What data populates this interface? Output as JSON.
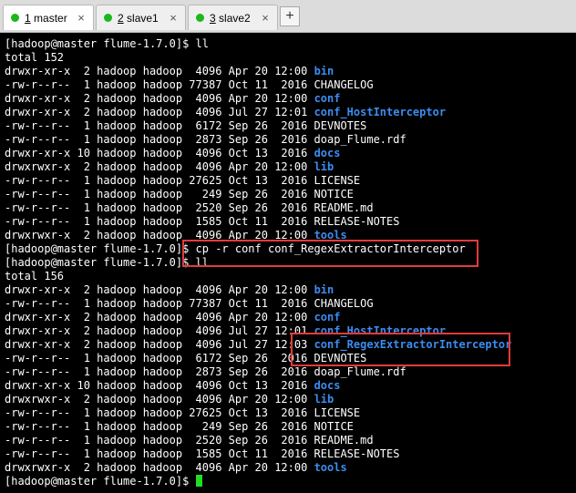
{
  "tabs": [
    {
      "num": "1",
      "name": "master",
      "close": "×"
    },
    {
      "num": "2",
      "name": "slave1",
      "close": "×"
    },
    {
      "num": "3",
      "name": "slave2",
      "close": "×"
    }
  ],
  "add_tab_label": "+",
  "colors": {
    "dir": "#3b8df0",
    "highlight": "#e23b3b",
    "status_dot": "#1bb81b",
    "cursor": "#22dd22"
  },
  "terminal": {
    "lines": [
      {
        "text": "[hadoop@master flume-1.7.0]$ ll"
      },
      {
        "text": "total 152"
      },
      {
        "text": "drwxr-xr-x  2 hadoop hadoop  4096 Apr 20 12:00 ",
        "dir": "bin"
      },
      {
        "text": "-rw-r--r--  1 hadoop hadoop 77387 Oct 11  2016 CHANGELOG"
      },
      {
        "text": "drwxr-xr-x  2 hadoop hadoop  4096 Apr 20 12:00 ",
        "dir": "conf"
      },
      {
        "text": "drwxr-xr-x  2 hadoop hadoop  4096 Jul 27 12:01 ",
        "dir": "conf_HostInterceptor"
      },
      {
        "text": "-rw-r--r--  1 hadoop hadoop  6172 Sep 26  2016 DEVNOTES"
      },
      {
        "text": "-rw-r--r--  1 hadoop hadoop  2873 Sep 26  2016 doap_Flume.rdf"
      },
      {
        "text": "drwxr-xr-x 10 hadoop hadoop  4096 Oct 13  2016 ",
        "dir": "docs"
      },
      {
        "text": "drwxrwxr-x  2 hadoop hadoop  4096 Apr 20 12:00 ",
        "dir": "lib"
      },
      {
        "text": "-rw-r--r--  1 hadoop hadoop 27625 Oct 13  2016 LICENSE"
      },
      {
        "text": "-rw-r--r--  1 hadoop hadoop   249 Sep 26  2016 NOTICE"
      },
      {
        "text": "-rw-r--r--  1 hadoop hadoop  2520 Sep 26  2016 README.md"
      },
      {
        "text": "-rw-r--r--  1 hadoop hadoop  1585 Oct 11  2016 RELEASE-NOTES"
      },
      {
        "text": "drwxrwxr-x  2 hadoop hadoop  4096 Apr 20 12:00 ",
        "dir": "tools"
      },
      {
        "text": "[hadoop@master flume-1.7.0]$ cp -r conf conf_RegexExtractorInterceptor"
      },
      {
        "text": "[hadoop@master flume-1.7.0]$ ll"
      },
      {
        "text": "total 156"
      },
      {
        "text": "drwxr-xr-x  2 hadoop hadoop  4096 Apr 20 12:00 ",
        "dir": "bin"
      },
      {
        "text": "-rw-r--r--  1 hadoop hadoop 77387 Oct 11  2016 CHANGELOG"
      },
      {
        "text": "drwxr-xr-x  2 hadoop hadoop  4096 Apr 20 12:00 ",
        "dir": "conf"
      },
      {
        "text": "drwxr-xr-x  2 hadoop hadoop  4096 Jul 27 12:01 ",
        "dir": "conf_HostInterceptor"
      },
      {
        "text": "drwxr-xr-x  2 hadoop hadoop  4096 Jul 27 12:03 ",
        "dir": "conf_RegexExtractorInterceptor"
      },
      {
        "text": "-rw-r--r--  1 hadoop hadoop  6172 Sep 26  2016 DEVNOTES"
      },
      {
        "text": "-rw-r--r--  1 hadoop hadoop  2873 Sep 26  2016 doap_Flume.rdf"
      },
      {
        "text": "drwxr-xr-x 10 hadoop hadoop  4096 Oct 13  2016 ",
        "dir": "docs"
      },
      {
        "text": "drwxrwxr-x  2 hadoop hadoop  4096 Apr 20 12:00 ",
        "dir": "lib"
      },
      {
        "text": "-rw-r--r--  1 hadoop hadoop 27625 Oct 13  2016 LICENSE"
      },
      {
        "text": "-rw-r--r--  1 hadoop hadoop   249 Sep 26  2016 NOTICE"
      },
      {
        "text": "-rw-r--r--  1 hadoop hadoop  2520 Sep 26  2016 README.md"
      },
      {
        "text": "-rw-r--r--  1 hadoop hadoop  1585 Oct 11  2016 RELEASE-NOTES"
      },
      {
        "text": "drwxrwxr-x  2 hadoop hadoop  4096 Apr 20 12:00 ",
        "dir": "tools"
      },
      {
        "text": "[hadoop@master flume-1.7.0]$ ",
        "cursor": true
      }
    ]
  }
}
